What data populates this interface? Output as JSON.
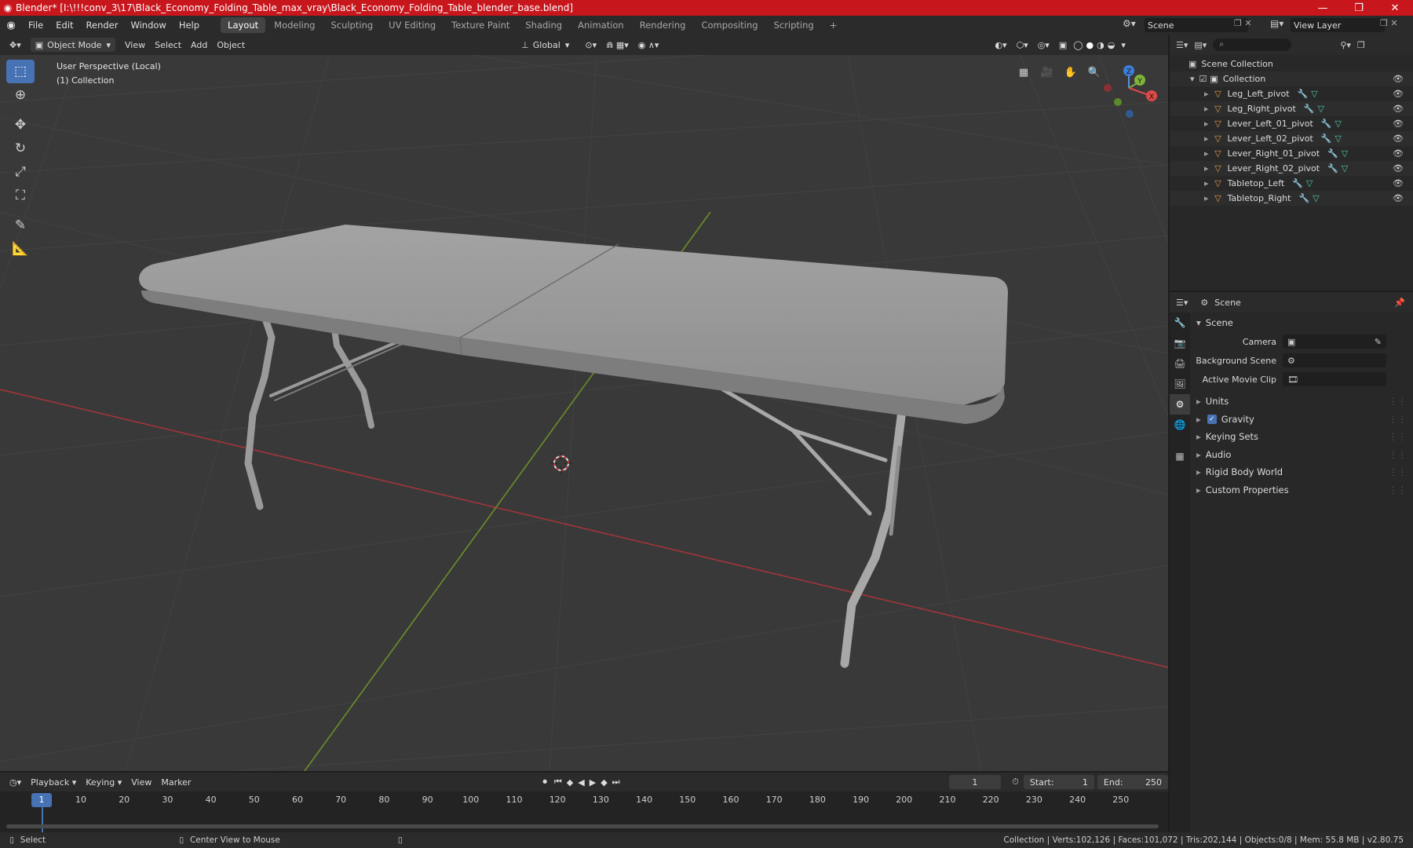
{
  "titlebar": {
    "title": "Blender* [I:\\!!!conv_3\\17\\Black_Economy_Folding_Table_max_vray\\Black_Economy_Folding_Table_blender_base.blend]",
    "minimize": "—",
    "maximize": "❐",
    "close": "✕"
  },
  "menu": {
    "items": [
      "File",
      "Edit",
      "Render",
      "Window",
      "Help"
    ],
    "workspaces": [
      "Layout",
      "Modeling",
      "Sculpting",
      "UV Editing",
      "Texture Paint",
      "Shading",
      "Animation",
      "Rendering",
      "Compositing",
      "Scripting"
    ],
    "active_workspace": "Layout",
    "add_tab": "+",
    "scene_name": "Scene",
    "view_layer": "View Layer"
  },
  "viewport_header": {
    "mode": "Object Mode",
    "menus": [
      "View",
      "Select",
      "Add",
      "Object"
    ],
    "orientation": "Global"
  },
  "viewport": {
    "perspective_label": "User Perspective (Local)",
    "collection_label": "(1) Collection",
    "gizmo": {
      "x": "X",
      "y": "Y",
      "z": "Z"
    }
  },
  "outliner": {
    "search_placeholder": "",
    "scene_collection": "Scene Collection",
    "collection": "Collection",
    "objects": [
      "Leg_Left_pivot",
      "Leg_Right_pivot",
      "Lever_Left_01_pivot",
      "Lever_Left_02_pivot",
      "Lever_Right_01_pivot",
      "Lever_Right_02_pivot",
      "Tabletop_Left",
      "Tabletop_Right"
    ]
  },
  "properties": {
    "header": "Scene",
    "section": "Scene",
    "fields": [
      {
        "label": "Camera",
        "value": ""
      },
      {
        "label": "Background Scene",
        "value": ""
      },
      {
        "label": "Active Movie Clip",
        "value": ""
      }
    ],
    "panels": [
      "Units",
      "Gravity",
      "Keying Sets",
      "Audio",
      "Rigid Body World",
      "Custom Properties"
    ],
    "gravity_checked": true
  },
  "timeline": {
    "menus": [
      "Playback",
      "Keying",
      "View",
      "Marker"
    ],
    "current_frame": "1",
    "start_label": "Start:",
    "start": "1",
    "end_label": "End:",
    "end": "250",
    "ruler": [
      "10",
      "20",
      "30",
      "40",
      "50",
      "60",
      "70",
      "80",
      "90",
      "100",
      "110",
      "120",
      "130",
      "140",
      "150",
      "160",
      "170",
      "180",
      "190",
      "200",
      "210",
      "220",
      "230",
      "240",
      "250"
    ],
    "playhead": "1"
  },
  "statusbar": {
    "select": "Select",
    "center": "Center View to Mouse",
    "stats": "Collection | Verts:102,126 | Faces:101,072 | Tris:202,144 | Objects:0/8 | Mem: 55.8 MB | v2.80.75"
  },
  "colors": {
    "titlebar": "#c8161d",
    "accent": "#4772b3",
    "object_icon": "#e49a4c",
    "x_axis": "#c0393f",
    "y_axis": "#6f9a2a"
  }
}
